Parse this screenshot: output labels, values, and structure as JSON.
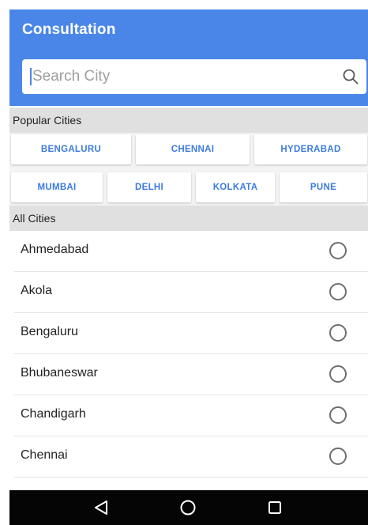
{
  "header": {
    "title": "Consultation",
    "color": "#4a86e8"
  },
  "search": {
    "placeholder": "Search City",
    "value": "",
    "icon": "search-icon"
  },
  "popular": {
    "heading": "Popular Cities",
    "cities": [
      "BENGALURU",
      "CHENNAI",
      "HYDERABAD",
      "MUMBAI",
      "DELHI",
      "KOLKATA",
      "PUNE"
    ]
  },
  "all_cities": {
    "heading": "All Cities",
    "items": [
      {
        "name": "Ahmedabad",
        "selected": false
      },
      {
        "name": "Akola",
        "selected": false
      },
      {
        "name": "Bengaluru",
        "selected": false
      },
      {
        "name": "Bhubaneswar",
        "selected": false
      },
      {
        "name": "Chandigarh",
        "selected": false
      },
      {
        "name": "Chennai",
        "selected": false
      }
    ]
  },
  "navbar": {
    "buttons": [
      "back-triangle-icon",
      "home-circle-icon",
      "recents-square-icon"
    ]
  }
}
